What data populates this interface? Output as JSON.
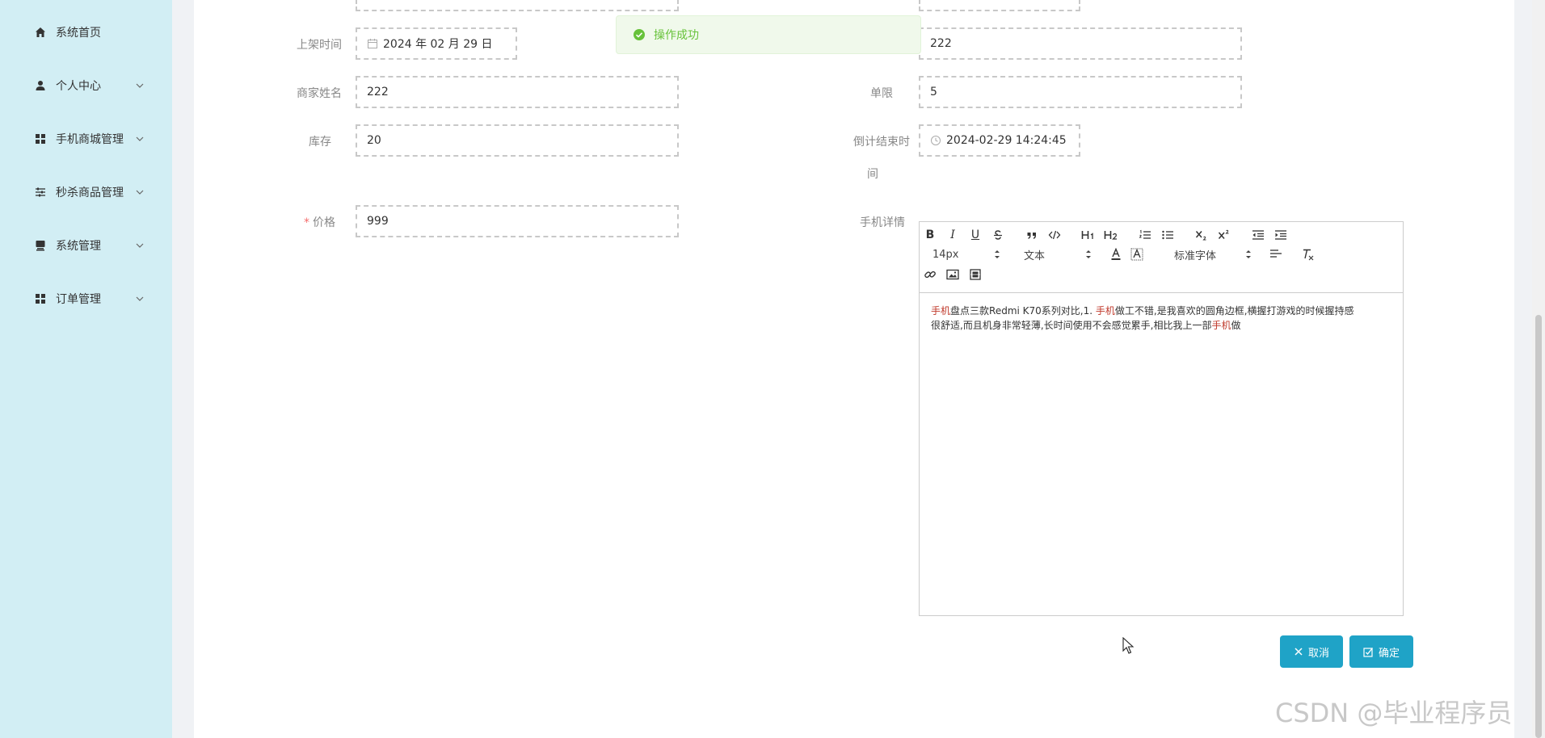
{
  "sidebar": {
    "items": [
      {
        "label": "系统首页",
        "icon": "home-icon",
        "has_submenu": false
      },
      {
        "label": "个人中心",
        "icon": "user-icon",
        "has_submenu": true
      },
      {
        "label": "手机商城管理",
        "icon": "grid-icon",
        "has_submenu": true
      },
      {
        "label": "秒杀商品管理",
        "icon": "sliders-icon",
        "has_submenu": true
      },
      {
        "label": "系统管理",
        "icon": "monitor-icon",
        "has_submenu": true
      },
      {
        "label": "订单管理",
        "icon": "grid-icon",
        "has_submenu": true
      }
    ]
  },
  "toast": {
    "text": "操作成功",
    "type": "success",
    "color": "#67c23a"
  },
  "form": {
    "listing_time": {
      "label": "上架时间",
      "value": "2024 年 02 月 29 日"
    },
    "top_right_value": "222",
    "merchant_name": {
      "label": "商家姓名",
      "value": "222"
    },
    "limit": {
      "label": "单限",
      "value": "5"
    },
    "stock": {
      "label": "库存",
      "value": "20"
    },
    "countdown_end": {
      "label_line1": "倒计结束时",
      "label_line2": "间",
      "value": "2024-02-29 14:24:45"
    },
    "price": {
      "label": "价格",
      "required_mark": "*",
      "value": "999"
    },
    "details": {
      "label": "手机详情"
    }
  },
  "editor": {
    "toolbar": {
      "bold": "B",
      "italic": "I",
      "underline": "U",
      "size_select": "14px",
      "header_select": "文本",
      "font_select": "标准字体"
    },
    "content": {
      "line1": [
        {
          "text": "手机",
          "highlight": true
        },
        {
          "text": "盘点三款Redmi K70系列对比,1. ",
          "highlight": false
        },
        {
          "text": "手机",
          "highlight": true
        },
        {
          "text": "做工不错,是我喜欢的圆角边框,横握打游戏的时候握持感",
          "highlight": false
        }
      ],
      "line2": [
        {
          "text": "很舒适,而且机身非常轻薄,长时间使用不会感觉累手,相比我上一部",
          "highlight": false
        },
        {
          "text": "手机",
          "highlight": true
        },
        {
          "text": "做",
          "highlight": false
        }
      ]
    },
    "highlight_color": "#c0392b"
  },
  "buttons": {
    "cancel": "取消",
    "confirm": "确定"
  },
  "accent_color": "#1fa3c7",
  "sidebar_color": "#d2eef4",
  "watermark": "CSDN @毕业程序员"
}
